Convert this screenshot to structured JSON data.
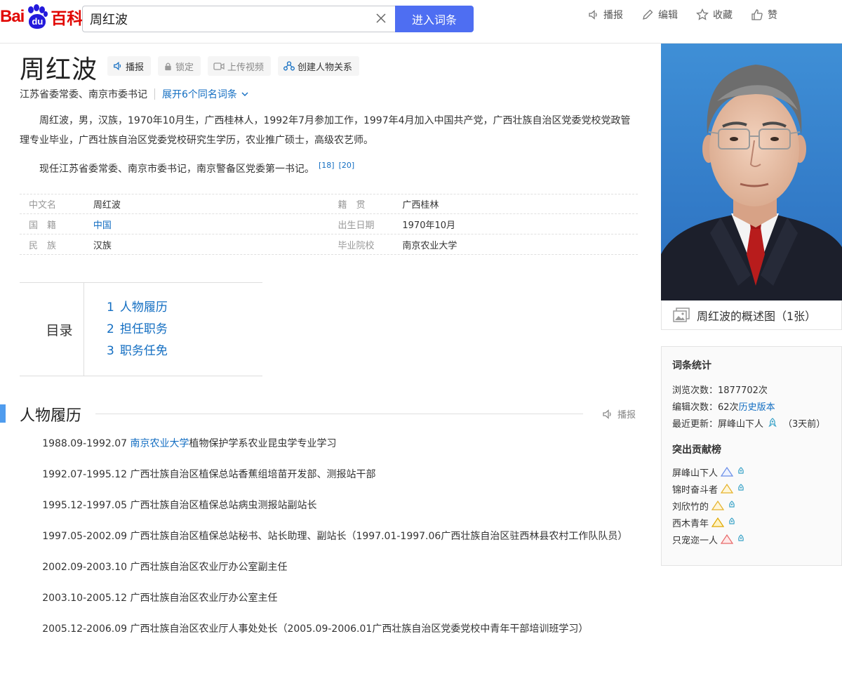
{
  "header": {
    "logo_bai": "Bai",
    "logo_du": "du",
    "logo_baike": "百科",
    "search_value": "周红波",
    "search_button": "进入词条",
    "actions": [
      "播报",
      "编辑",
      "收藏",
      "赞"
    ]
  },
  "title": {
    "name": "周红波",
    "tools": [
      "播报",
      "锁定",
      "上传视频",
      "创建人物关系"
    ],
    "subtitle": "江苏省委常委、南京市委书记",
    "expand": "展开6个同名词条"
  },
  "intro": {
    "p1": "周红波，男，汉族，1970年10月生，广西桂林人，1992年7月参加工作，1997年4月加入中国共产党，广西壮族自治区党委党校党政管理专业毕业，广西壮族自治区党委党校研究生学历，农业推广硕士，高级农艺师。",
    "p2": "现任江苏省委常委、南京市委书记，南京警备区党委第一书记。",
    "ref1": "[18]",
    "ref2": "[20]"
  },
  "basic_info": {
    "rows": [
      {
        "l1": "中文名",
        "v1": "周红波",
        "l2": "籍　贯",
        "v2": "广西桂林"
      },
      {
        "l1": "国　籍",
        "v1": "中国",
        "l2": "出生日期",
        "v2": "1970年10月"
      },
      {
        "l1": "民　族",
        "v1": "汉族",
        "l2": "毕业院校",
        "v2": "南京农业大学"
      }
    ]
  },
  "catalog": {
    "title": "目录",
    "items": [
      {
        "num": "1",
        "label": "人物履历"
      },
      {
        "num": "2",
        "label": "担任职务"
      },
      {
        "num": "3",
        "label": "职务任免"
      }
    ]
  },
  "section": {
    "title": "人物履历",
    "read": "播报"
  },
  "career": {
    "item0_prefix": "1988.09-1992.07 ",
    "item0_link": "南京农业大学",
    "item0_suffix": "植物保护学系农业昆虫学专业学习",
    "items": [
      "1992.07-1995.12 广西壮族自治区植保总站香蕉组培苗开发部、测报站干部",
      "1995.12-1997.05 广西壮族自治区植保总站病虫测报站副站长",
      "1997.05-2002.09 广西壮族自治区植保总站秘书、站长助理、副站长（1997.01-1997.06广西壮族自治区驻西林县农村工作队队员）",
      "2002.09-2003.10 广西壮族自治区农业厅办公室副主任",
      "2003.10-2005.12 广西壮族自治区农业厅办公室主任",
      "2005.12-2006.09 广西壮族自治区农业厅人事处处长（2005.09-2006.01广西壮族自治区党委党校中青年干部培训班学习）"
    ]
  },
  "sidebar": {
    "photo_caption": "周红波的概述图（1张）",
    "stats_title": "词条统计",
    "views_label": "浏览次数：",
    "views_value": "1877702次",
    "edits_label": "编辑次数：",
    "edits_value": "62次",
    "history_link": "历史版本",
    "update_label": "最近更新：",
    "update_user": "屏峰山下人",
    "update_time": "（3天前）",
    "contrib_title": "突出贡献榜",
    "contributors": [
      "屏峰山下人",
      "锦时奋斗者",
      "刘欣竹的",
      "西木青年",
      "只宠迩一人"
    ]
  },
  "colors": {
    "brand_red": "#e10602",
    "brand_blue": "#2319dc",
    "search_button": "#4e6ef2",
    "link": "#136ec2",
    "section_bar": "#4f9cee"
  }
}
